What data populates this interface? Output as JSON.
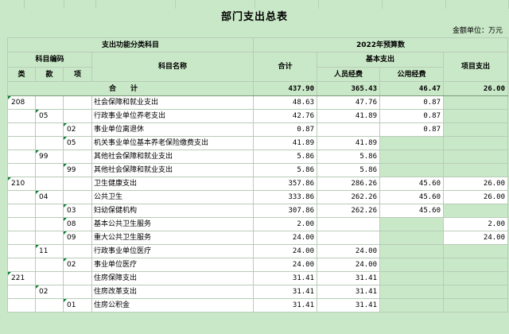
{
  "title": "部门支出总表",
  "unit_label": "金额单位：万元",
  "headers": {
    "classification": "支出功能分类科目",
    "budget_year": "2022年预算数",
    "subject_code": "科目编码",
    "subject_name": "科目名称",
    "total": "合计",
    "basic": "基本支出",
    "project": "项目支出",
    "personnel": "人员经费",
    "public": "公用经费",
    "lei": "类",
    "kuan": "款",
    "xiang": "项"
  },
  "total_row": {
    "label": "合计",
    "total": "437.90",
    "personnel": "365.43",
    "public": "46.47",
    "project": "26.00"
  },
  "rows": [
    {
      "lei": "208",
      "kuan": "",
      "xiang": "",
      "name": "社会保障和就业支出",
      "total": "48.63",
      "personnel": "47.76",
      "public": "0.87",
      "project": ""
    },
    {
      "lei": "",
      "kuan": "05",
      "xiang": "",
      "name": "行政事业单位养老支出",
      "total": "42.76",
      "personnel": "41.89",
      "public": "0.87",
      "project": ""
    },
    {
      "lei": "",
      "kuan": "",
      "xiang": "02",
      "name": "事业单位离退休",
      "total": "0.87",
      "personnel": "",
      "public": "0.87",
      "project": ""
    },
    {
      "lei": "",
      "kuan": "",
      "xiang": "05",
      "name": "机关事业单位基本养老保险缴费支出",
      "total": "41.89",
      "personnel": "41.89",
      "public": "",
      "project": ""
    },
    {
      "lei": "",
      "kuan": "99",
      "xiang": "",
      "name": "其他社会保障和就业支出",
      "total": "5.86",
      "personnel": "5.86",
      "public": "",
      "project": ""
    },
    {
      "lei": "",
      "kuan": "",
      "xiang": "99",
      "name": "其他社会保障和就业支出",
      "total": "5.86",
      "personnel": "5.86",
      "public": "",
      "project": ""
    },
    {
      "lei": "210",
      "kuan": "",
      "xiang": "",
      "name": "卫生健康支出",
      "total": "357.86",
      "personnel": "286.26",
      "public": "45.60",
      "project": "26.00"
    },
    {
      "lei": "",
      "kuan": "04",
      "xiang": "",
      "name": "公共卫生",
      "total": "333.86",
      "personnel": "262.26",
      "public": "45.60",
      "project": "26.00"
    },
    {
      "lei": "",
      "kuan": "",
      "xiang": "03",
      "name": "妇幼保健机构",
      "total": "307.86",
      "personnel": "262.26",
      "public": "45.60",
      "project": ""
    },
    {
      "lei": "",
      "kuan": "",
      "xiang": "08",
      "name": "基本公共卫生服务",
      "total": "2.00",
      "personnel": "",
      "public": "",
      "project": "2.00"
    },
    {
      "lei": "",
      "kuan": "",
      "xiang": "09",
      "name": "重大公共卫生服务",
      "total": "24.00",
      "personnel": "",
      "public": "",
      "project": "24.00"
    },
    {
      "lei": "",
      "kuan": "11",
      "xiang": "",
      "name": "行政事业单位医疗",
      "total": "24.00",
      "personnel": "24.00",
      "public": "",
      "project": ""
    },
    {
      "lei": "",
      "kuan": "",
      "xiang": "02",
      "name": "事业单位医疗",
      "total": "24.00",
      "personnel": "24.00",
      "public": "",
      "project": ""
    },
    {
      "lei": "221",
      "kuan": "",
      "xiang": "",
      "name": "住房保障支出",
      "total": "31.41",
      "personnel": "31.41",
      "public": "",
      "project": ""
    },
    {
      "lei": "",
      "kuan": "02",
      "xiang": "",
      "name": "住房改革支出",
      "total": "31.41",
      "personnel": "31.41",
      "public": "",
      "project": ""
    },
    {
      "lei": "",
      "kuan": "",
      "xiang": "01",
      "name": "住房公积金",
      "total": "31.41",
      "personnel": "31.41",
      "public": "",
      "project": ""
    }
  ]
}
